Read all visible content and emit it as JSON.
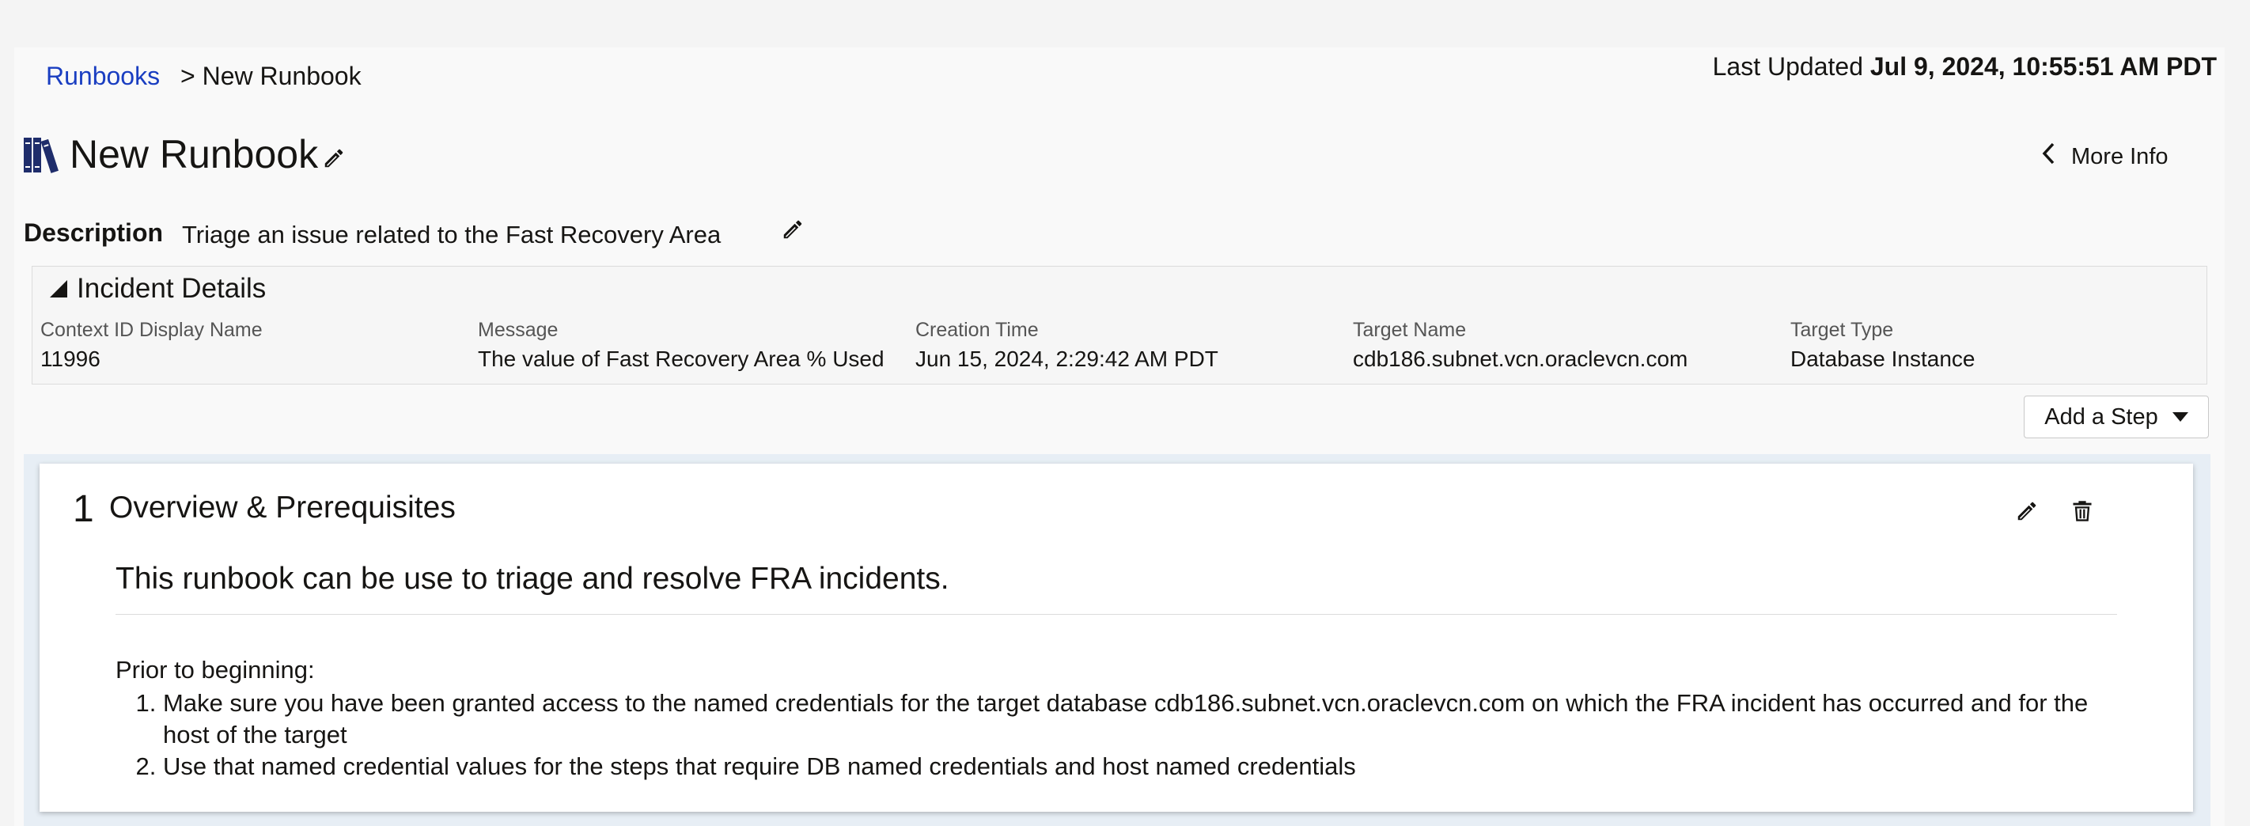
{
  "breadcrumb": {
    "root": "Runbooks",
    "current": "> New Runbook"
  },
  "last_updated": {
    "label": "Last Updated",
    "value": "Jul 9, 2024, 10:55:51 AM PDT"
  },
  "runbook": {
    "title": "New Runbook"
  },
  "header": {
    "more_info": "More Info"
  },
  "description": {
    "label": "Description",
    "value": "Triage an issue related to the Fast Recovery Area"
  },
  "incident": {
    "title": "Incident Details",
    "fields": [
      {
        "label": "Context ID Display Name",
        "value": "11996"
      },
      {
        "label": "Message",
        "value": "The value of Fast Recovery Area % Used"
      },
      {
        "label": "Creation Time",
        "value": "Jun 15, 2024, 2:29:42 AM PDT"
      },
      {
        "label": "Target Name",
        "value": "cdb186.subnet.vcn.oraclevcn.com"
      },
      {
        "label": "Target Type",
        "value": "Database Instance"
      }
    ]
  },
  "toolbar": {
    "add_step": "Add a Step"
  },
  "step": {
    "number": "1",
    "title": "Overview & Prerequisites",
    "heading": "This runbook can be use to triage and resolve FRA incidents.",
    "prior": "Prior to beginning:",
    "items": [
      "Make sure you have been granted access to the named credentials for the target database cdb186.subnet.vcn.oraclevcn.com on which the FRA incident has occurred and for the host of the target",
      "Use that named credential values for the steps that require DB named credentials and host named credentials"
    ]
  },
  "colors": {
    "link": "#1a3ec1",
    "icon": "#1f2d6b",
    "text": "#161513"
  },
  "icons": {
    "title": "books-icon",
    "edit": "pencil-icon",
    "delete": "trash-icon",
    "back": "chevron-left-icon"
  }
}
